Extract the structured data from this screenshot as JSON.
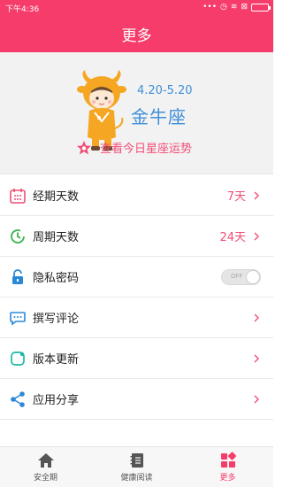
{
  "status_bar": {
    "time": "下午4:36",
    "icons": [
      "more-icon",
      "alarm-icon",
      "wifi-icon",
      "no-sim-icon",
      "battery-icon"
    ]
  },
  "app_bar": {
    "title": "更多"
  },
  "zodiac": {
    "dates": "4.20-5.20",
    "sign": "金牛座",
    "fortune_link": "查看今日星座运势"
  },
  "menu": {
    "period_days": {
      "label": "经期天数",
      "value": "7天"
    },
    "cycle_days": {
      "label": "周期天数",
      "value": "24天"
    },
    "privacy_password": {
      "label": "隐私密码",
      "toggle": "OFF",
      "enabled": false
    },
    "write_review": {
      "label": "撰写评论"
    },
    "version_update": {
      "label": "版本更新"
    },
    "share_app": {
      "label": "应用分享"
    }
  },
  "tabs": {
    "safe": "安全期",
    "health": "健康阅读",
    "more": "更多"
  },
  "colors": {
    "brand": "#f63c6b",
    "accent_blue": "#3f8fd8",
    "value_pink": "#f24d76"
  }
}
